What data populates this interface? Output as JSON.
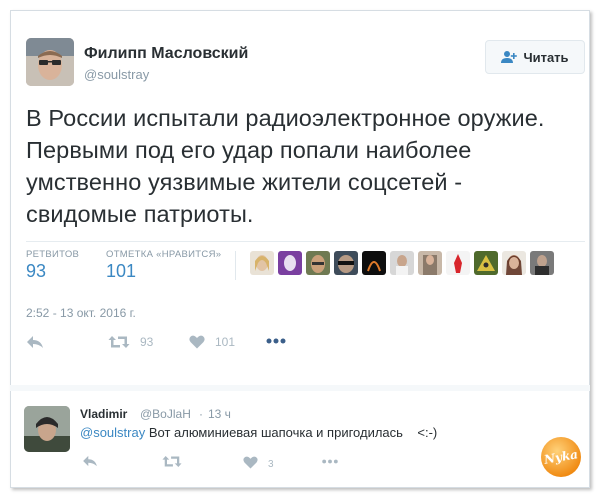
{
  "tweet": {
    "author_name": "Филипп Масловский",
    "author_handle": "@soulstray",
    "follow_label": "Читать",
    "text": "В России испытали радиоэлектронное оружие. Первыми под его удар попали наиболее умственно уязвимые жители соцсетей - свидомые патриоты.",
    "retweets_label": "РЕТВИТОВ",
    "retweets_count": "93",
    "likes_label": "ОТМЕТКА «НРАВИТСЯ»",
    "likes_count": "101",
    "timestamp": "2:52 - 13 окт. 2016 г.",
    "actions": {
      "reply_icon": "reply-icon",
      "retweet_icon": "retweet-icon",
      "retweet_count": "93",
      "like_icon": "heart-icon",
      "like_count": "101",
      "more_icon": "more-icon"
    }
  },
  "reply": {
    "author_name": "Vladimir",
    "author_handle": "@BoJlaH",
    "dot": "·",
    "time": "13 ч",
    "mention": "@soulstray",
    "text": " Вот алюминиевая шапочка и пригодилась    <:-)",
    "actions": {
      "reply_icon": "reply-icon",
      "retweet_icon": "retweet-icon",
      "like_icon": "heart-icon",
      "like_count": "3",
      "more_icon": "more-icon"
    }
  },
  "watermark": {
    "text": "Nyka"
  },
  "colors": {
    "link": "#3b88c3",
    "muted": "#8899a6",
    "text": "#292f33",
    "icon": "#aab8c2",
    "border": "#e1e8ed",
    "watermark": "#f39a1f"
  }
}
